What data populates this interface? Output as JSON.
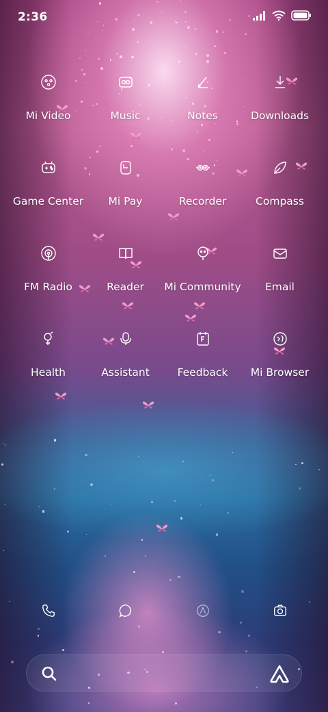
{
  "status_bar": {
    "time": "2:36",
    "icons": [
      "signal-icon",
      "wifi-icon",
      "battery-icon"
    ]
  },
  "apps": [
    {
      "label": "Mi Video",
      "icon": "video-icon"
    },
    {
      "label": "Music",
      "icon": "music-icon"
    },
    {
      "label": "Notes",
      "icon": "notes-icon"
    },
    {
      "label": "Downloads",
      "icon": "downloads-icon"
    },
    {
      "label": "Game Center",
      "icon": "gamepad-icon"
    },
    {
      "label": "Mi Pay",
      "icon": "wallet-icon"
    },
    {
      "label": "Recorder",
      "icon": "recorder-icon"
    },
    {
      "label": "Compass",
      "icon": "compass-icon"
    },
    {
      "label": "FM Radio",
      "icon": "radio-icon"
    },
    {
      "label": "Reader",
      "icon": "book-icon"
    },
    {
      "label": "Mi Community",
      "icon": "community-icon"
    },
    {
      "label": "Email",
      "icon": "envelope-icon"
    },
    {
      "label": "Health",
      "icon": "health-icon"
    },
    {
      "label": "Assistant",
      "icon": "assistant-mic-icon"
    },
    {
      "label": "Feedback",
      "icon": "feedback-icon"
    },
    {
      "label": "Mi Browser",
      "icon": "globe-icon"
    }
  ],
  "dock": [
    "phone-icon",
    "message-icon",
    "app-store-icon",
    "camera-icon"
  ],
  "search": {
    "placeholder": "",
    "left_icon": "search-icon",
    "right_icon": "assistant-triangle-icon"
  },
  "theme": {
    "wallpaper_top": "#b5598f",
    "wallpaper_bottom": "#214f86",
    "text": "#ffffff"
  }
}
